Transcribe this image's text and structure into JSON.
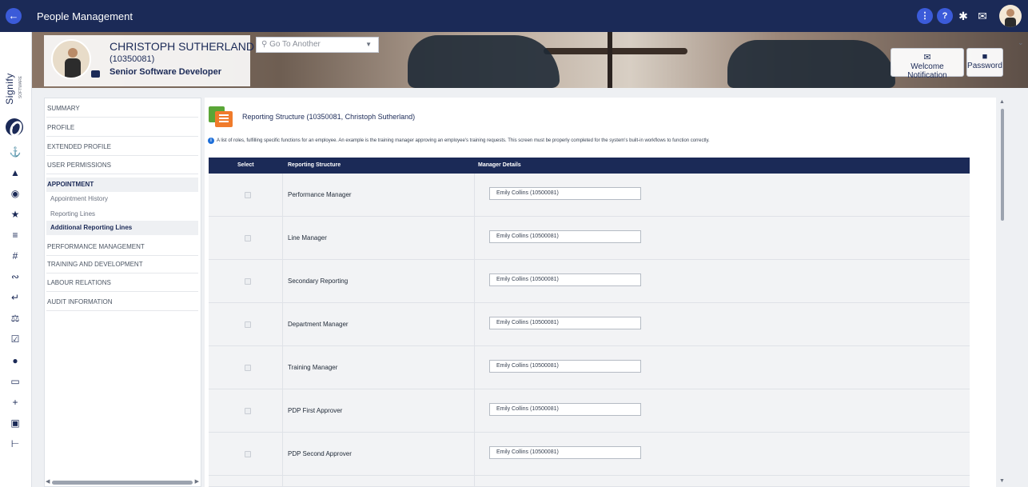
{
  "app": {
    "title": "People Management"
  },
  "topbar_icons": [
    "more-icon",
    "help-icon",
    "gear-icon",
    "mail-icon",
    "user-avatar"
  ],
  "brand": {
    "name": "Signify",
    "tagline": "SOFTWARE"
  },
  "employee": {
    "name": "CHRISTOPH SUTHERLAND",
    "id": "(10350081)",
    "title": "Senior Software Developer"
  },
  "goto": {
    "placeholder": "Go To Another"
  },
  "banner_buttons": {
    "welcome": "Welcome Notification",
    "password": "Password"
  },
  "nav": {
    "summary": "SUMMARY",
    "profile": "PROFILE",
    "extended_profile": "EXTENDED PROFILE",
    "user_permissions": "USER PERMISSIONS",
    "appointment": "APPOINTMENT",
    "appointment_history": "Appointment History",
    "reporting_lines": "Reporting Lines",
    "additional_reporting_lines": "Additional Reporting Lines",
    "performance_management": "PERFORMANCE MANAGEMENT",
    "training_and_development": "TRAINING AND DEVELOPMENT",
    "labour_relations": "LABOUR RELATIONS",
    "audit_information": "AUDIT INFORMATION"
  },
  "section": {
    "title": "Reporting Structure (10350081, Christoph Sutherland)",
    "info": "A list of roles, fulfilling specific functions for an employee. An example is the training manager approving an employee's training requests. This screen must be properly completed for the system's built-in workflows to function correctly."
  },
  "table": {
    "headers": {
      "select": "Select",
      "structure": "Reporting Structure",
      "manager": "Manager Details"
    },
    "rows": [
      {
        "role": "Performance Manager",
        "manager": "Emily Collins (10500081)"
      },
      {
        "role": "Line Manager",
        "manager": "Emily Collins (10500081)"
      },
      {
        "role": "Secondary Reporting",
        "manager": "Emily Collins (10500081)"
      },
      {
        "role": "Department Manager",
        "manager": "Emily Collins (10500081)"
      },
      {
        "role": "Training Manager",
        "manager": "Emily Collins (10500081)"
      },
      {
        "role": "PDP First Approver",
        "manager": "Emily Collins (10500081)"
      },
      {
        "role": "PDP Second Approver",
        "manager": "Emily Collins (10500081)"
      }
    ]
  },
  "colors": {
    "navy": "#1b2a57",
    "accent": "#3b5bd9"
  }
}
